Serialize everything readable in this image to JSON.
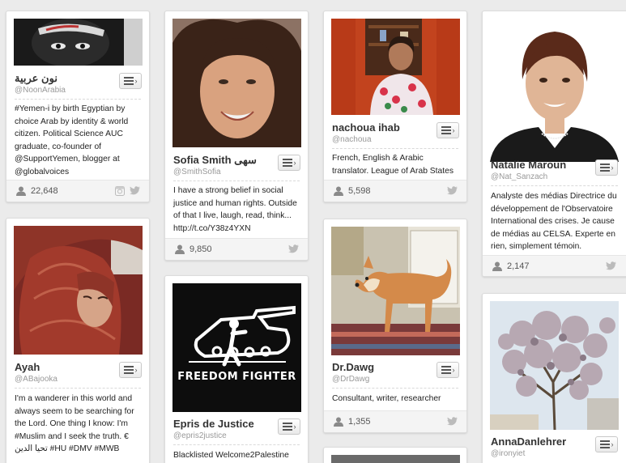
{
  "cards": [
    {
      "name": "نون عربية",
      "handle": "@NoonArabia",
      "bio": "#Yemen-i by birth Egyptian by choice Arab by identity & world citizen. Political Science AUC graduate, co-founder of @SupportYemen, blogger at @globalvoices",
      "followers": "22,648",
      "icons": [
        "instagram-icon",
        "twitter-icon"
      ]
    },
    {
      "name": "Sofia Smith سهى",
      "handle": "@SmithSofia",
      "bio": "I have a strong belief in social justice and human rights. Outside of that I live, laugh, read, think... http://t.co/Y38z4YXN",
      "followers": "9,850",
      "icons": [
        "twitter-icon"
      ]
    },
    {
      "name": "nachoua ihab",
      "handle": "@nachoua",
      "bio": "French, English & Arabic translator. League of Arab States",
      "followers": "5,598",
      "icons": [
        "twitter-icon"
      ]
    },
    {
      "name": "Natalie Maroun",
      "handle": "@Nat_Sanzach",
      "bio": "Analyste des médias Directrice du développement de l'Observatoire International des crises. Je cause de médias au CELSA. Experte en rien, simplement témoin.",
      "followers": "2,147",
      "icons": [
        "twitter-icon"
      ]
    },
    {
      "name": "Ayah",
      "handle": "@ABajooka",
      "bio": "I'm a wanderer in this world and always seem to be searching for the Lord. One thing I know: I'm #Muslim and I seek the truth. € تحيا الدين #HU #DMV #MWB"
    },
    {
      "name": "Epris de Justice",
      "handle": "@epris2justice",
      "bio": "Blacklisted Welcome2Palestine",
      "photo_text": "FREEDOM FIGHTER"
    },
    {
      "name": "Dr.Dawg",
      "handle": "@DrDawg",
      "bio": "Consultant, writer, researcher",
      "followers": "1,355",
      "icons": [
        "twitter-icon"
      ]
    },
    {
      "name": "AnnaDanlehrer",
      "handle": "@ironyiet"
    }
  ]
}
